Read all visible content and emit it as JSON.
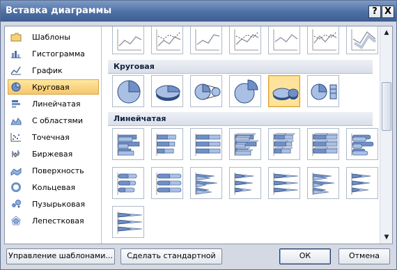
{
  "dialog": {
    "title": "Вставка диаграммы",
    "help_label": "?",
    "close_label": "X"
  },
  "categories": [
    {
      "label": "Шаблоны",
      "icon": "folder-icon"
    },
    {
      "label": "Гистограмма",
      "icon": "column-chart-icon"
    },
    {
      "label": "График",
      "icon": "line-chart-icon"
    },
    {
      "label": "Круговая",
      "icon": "pie-chart-icon",
      "selected": true
    },
    {
      "label": "Линейчатая",
      "icon": "bar-chart-icon"
    },
    {
      "label": "С областями",
      "icon": "area-chart-icon"
    },
    {
      "label": "Точечная",
      "icon": "scatter-chart-icon"
    },
    {
      "label": "Биржевая",
      "icon": "stock-chart-icon"
    },
    {
      "label": "Поверхность",
      "icon": "surface-chart-icon"
    },
    {
      "label": "Кольцевая",
      "icon": "doughnut-chart-icon"
    },
    {
      "label": "Пузырьковая",
      "icon": "bubble-chart-icon"
    },
    {
      "label": "Лепестковая",
      "icon": "radar-chart-icon"
    }
  ],
  "gallery": {
    "sections": [
      {
        "title": "Круговая"
      },
      {
        "title": "Линейчатая"
      }
    ],
    "line_thumbs": [
      "line",
      "line-markers",
      "stacked-line",
      "stacked-line-markers",
      "100-line",
      "100-line-markers",
      "3d-line"
    ],
    "pie_thumbs": [
      "pie",
      "3d-pie",
      "pie-of-pie",
      "exploded-pie",
      "3d-exploded-pie",
      "bar-of-pie"
    ],
    "bar_thumbs_row1": [
      "clustered-bar",
      "stacked-bar",
      "100-stacked-bar",
      "3d-clustered-bar",
      "3d-stacked-bar",
      "3d-100-stacked-bar",
      "clustered-cylinder-bar"
    ],
    "bar_thumbs_row2": [
      "stacked-cylinder-bar",
      "100-stacked-cylinder-bar",
      "clustered-cone-bar",
      "stacked-cone-bar",
      "100-stacked-cone-bar",
      "clustered-pyramid-bar",
      "stacked-pyramid-bar"
    ],
    "bar_thumbs_row3": [
      "100-stacked-pyramid-bar"
    ],
    "selected": "3d-exploded-pie"
  },
  "buttons": {
    "manage_templates": "Управление шаблонами...",
    "set_default": "Сделать стандартной",
    "ok": "ОК",
    "cancel": "Отмена"
  },
  "colors": {
    "title_bar": "#4d6fa4",
    "selection": "#f7c56a",
    "chart_blue": "#6f8fc6"
  }
}
